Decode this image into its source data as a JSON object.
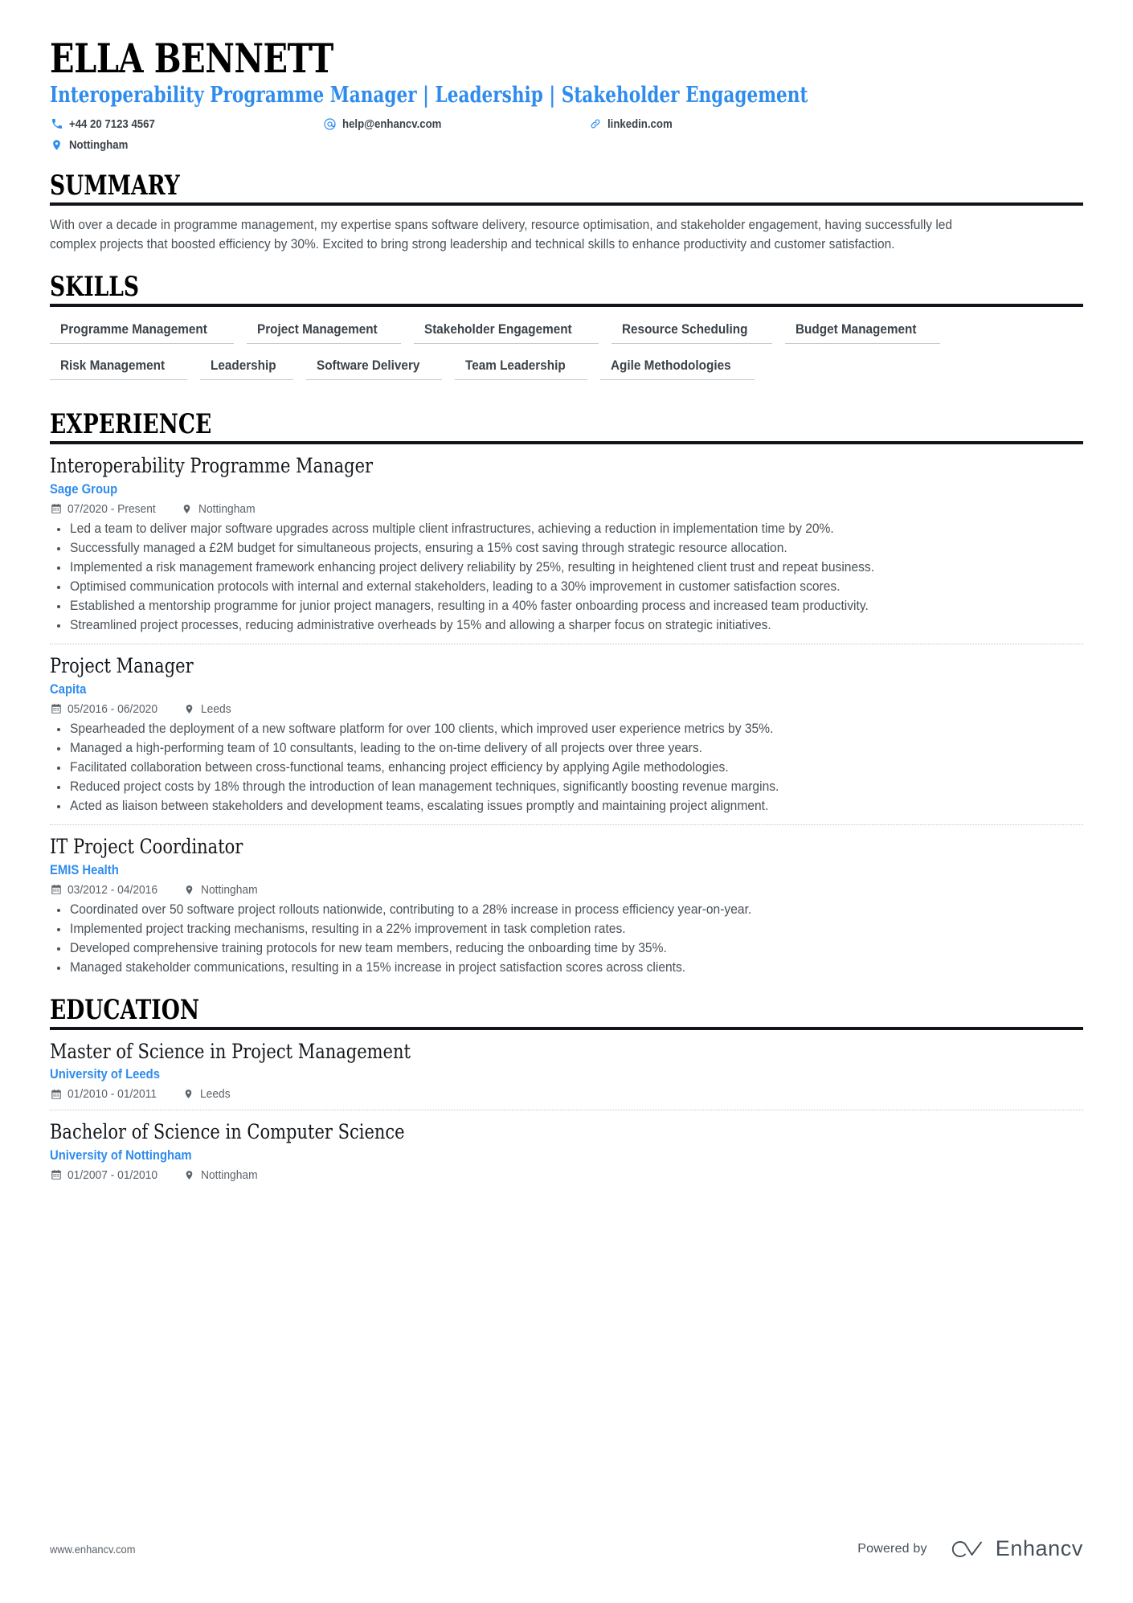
{
  "header": {
    "name": "ELLA BENNETT",
    "headline": "Interoperability Programme Manager | Leadership | Stakeholder Engagement",
    "accent_color": "#2f8ced",
    "contacts": [
      {
        "icon": "phone-icon",
        "text": "+44 20 7123 4567"
      },
      {
        "icon": "email-icon",
        "text": "help@enhancv.com"
      },
      {
        "icon": "link-icon",
        "text": "linkedin.com"
      },
      {
        "icon": "location-icon",
        "text": "Nottingham"
      }
    ]
  },
  "sections": {
    "summary": {
      "heading": "SUMMARY",
      "text": "With over a decade in programme management, my expertise spans software delivery, resource optimisation, and stakeholder engagement, having successfully led complex projects that boosted efficiency by 30%. Excited to bring strong leadership and technical skills to enhance productivity and customer satisfaction."
    },
    "skills": {
      "heading": "SKILLS",
      "items": [
        "Programme Management",
        "Project Management",
        "Stakeholder Engagement",
        "Resource Scheduling",
        "Budget Management",
        "Risk Management",
        "Leadership",
        "Software Delivery",
        "Team Leadership",
        "Agile Methodologies"
      ]
    },
    "experience": {
      "heading": "EXPERIENCE",
      "entries": [
        {
          "title": "Interoperability Programme Manager",
          "organisation": "Sage Group",
          "dates": "07/2020 - Present",
          "location": "Nottingham",
          "bullets": [
            "Led a team to deliver major software upgrades across multiple client infrastructures, achieving a reduction in implementation time by 20%.",
            "Successfully managed a £2M budget for simultaneous projects, ensuring a 15% cost saving through strategic resource allocation.",
            "Implemented a risk management framework enhancing project delivery reliability by 25%, resulting in heightened client trust and repeat business.",
            "Optimised communication protocols with internal and external stakeholders, leading to a 30% improvement in customer satisfaction scores.",
            "Established a mentorship programme for junior project managers, resulting in a 40% faster onboarding process and increased team productivity.",
            "Streamlined project processes, reducing administrative overheads by 15% and allowing a sharper focus on strategic initiatives."
          ]
        },
        {
          "title": "Project Manager",
          "organisation": "Capita",
          "dates": "05/2016 - 06/2020",
          "location": "Leeds",
          "bullets": [
            "Spearheaded the deployment of a new software platform for over 100 clients, which improved user experience metrics by 35%.",
            "Managed a high-performing team of 10 consultants, leading to the on-time delivery of all projects over three years.",
            "Facilitated collaboration between cross-functional teams, enhancing project efficiency by applying Agile methodologies.",
            "Reduced project costs by 18% through the introduction of lean management techniques, significantly boosting revenue margins.",
            "Acted as liaison between stakeholders and development teams, escalating issues promptly and maintaining project alignment."
          ]
        },
        {
          "title": "IT Project Coordinator",
          "organisation": "EMIS Health",
          "dates": "03/2012 - 04/2016",
          "location": "Nottingham",
          "bullets": [
            "Coordinated over 50 software project rollouts nationwide, contributing to a 28% increase in process efficiency year-on-year.",
            "Implemented project tracking mechanisms, resulting in a 22% improvement in task completion rates.",
            "Developed comprehensive training protocols for new team members, reducing the onboarding time by 35%.",
            "Managed stakeholder communications, resulting in a 15% increase in project satisfaction scores across clients."
          ]
        }
      ]
    },
    "education": {
      "heading": "EDUCATION",
      "entries": [
        {
          "title": "Master of Science in Project Management",
          "organisation": "University of Leeds",
          "dates": "01/2010 - 01/2011",
          "location": "Leeds"
        },
        {
          "title": "Bachelor of Science in Computer Science",
          "organisation": "University of Nottingham",
          "dates": "01/2007 - 01/2010",
          "location": "Nottingham"
        }
      ]
    }
  },
  "footer": {
    "url": "www.enhancv.com",
    "powered_by": "Powered by",
    "brand": "Enhancv"
  }
}
